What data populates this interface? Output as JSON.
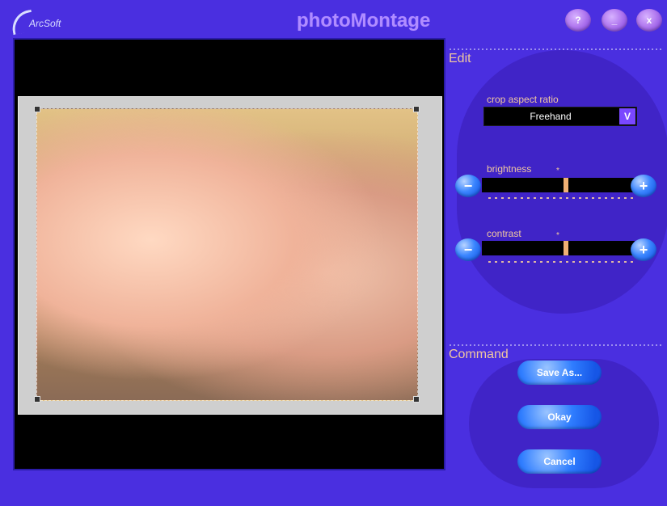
{
  "app": {
    "brand": "ArcSoft",
    "title": "photoMontage",
    "window_buttons": [
      "?",
      "_",
      "x"
    ]
  },
  "edit": {
    "section_title": "Edit",
    "crop_aspect_ratio": {
      "label": "crop aspect ratio",
      "value": "Freehand",
      "dropdown_glyph": "V"
    },
    "brightness": {
      "label": "brightness",
      "value_fraction": 0.55
    },
    "contrast": {
      "label": "contrast",
      "value_fraction": 0.55
    }
  },
  "command": {
    "section_title": "Command",
    "buttons": [
      "Save As...",
      "Okay",
      "Cancel"
    ]
  },
  "colors": {
    "background": "#4b2ee0",
    "accent_label": "#f0c7a0",
    "primary_button": "#2f7dff",
    "title_purple": "#b08cff"
  },
  "icons": {
    "help": "question-icon",
    "minimize": "minimize-icon",
    "close": "close-icon",
    "dropdown": "chevron-down-icon",
    "minus": "minus-icon",
    "plus": "plus-icon"
  }
}
